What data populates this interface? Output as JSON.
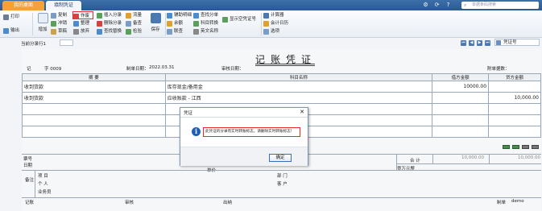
{
  "tabs": [
    {
      "label": "我的桌面"
    },
    {
      "label": "填制凭证"
    }
  ],
  "search": {
    "placeholder": "单据条码搜索"
  },
  "ribbon": {
    "print_label": "打印",
    "output_label": "输出",
    "add_label": "增加",
    "copy_label": "复制",
    "reverse_label": "冲销",
    "draft_label": "草稿",
    "void_label": "作废",
    "organize_label": "整理",
    "abandon_label": "放弃",
    "insert_entry_label": "插入分录",
    "delete_entry_label": "删除分录",
    "find_replace_label": "查找替换",
    "flow_label": "流量",
    "note_label": "备查",
    "check_label": "检验",
    "save_label": "保存",
    "aux_detail_label": "辅助明细",
    "balance_label": "余额",
    "link_label": "联查",
    "find_voucher_label": "查找分单",
    "subject_convert_label": "科目转换",
    "flow_convert_label": "英文名称",
    "show_voucher_no_label": "显示空凭证号",
    "calculator_label": "计算器",
    "accounting_calendar_label": "会计日历",
    "options_label": "选项"
  },
  "toolbar2": {
    "attach_label": "当前分录行1",
    "search_field": "凭证号"
  },
  "voucher": {
    "title": "记账凭证",
    "type_label": "记",
    "number_label": "字 0009",
    "date_label": "制单日期：",
    "date_value": "2022.03.31",
    "audit_label": "审核日期：",
    "attach_label": "附单据数：",
    "col_summary": "摘 要",
    "col_subject": "科目名称",
    "col_debit": "借方金额",
    "col_credit": "贷方金额",
    "rows": [
      {
        "summary": "收到货款",
        "subject": "库存现金/备用金",
        "debit": "10000.00",
        "credit": ""
      },
      {
        "summary": "收到货款",
        "subject": "应收账款 - 江西",
        "debit": "",
        "credit": "10,000.00"
      },
      {
        "summary": "",
        "subject": "",
        "debit": "",
        "credit": ""
      },
      {
        "summary": "",
        "subject": "",
        "debit": "",
        "credit": ""
      },
      {
        "summary": "",
        "subject": "",
        "debit": "",
        "credit": ""
      }
    ],
    "bill_no_label": "票号",
    "bill_date_label": "日期",
    "quantity_label": "数量",
    "price_label": "单价",
    "total_label": "合 计",
    "total_debit": "10,000.00",
    "total_credit": "10,000.00",
    "amount_in_words": "壹万元整",
    "note_label": "备注",
    "project_label": "项 目",
    "dept_label": "部 门",
    "person_label": "个 人",
    "customer_label": "客 户",
    "salesman_label": "业务员",
    "bookkeeper_label": "记账",
    "reviewer_label": "审核",
    "cashier_label": "出纳",
    "maker_label": "制单",
    "maker_value": "demo"
  },
  "dialog": {
    "title": "凭证",
    "message": "此凭证的分录有实时转账标志，请删除实时转账标志！",
    "ok_label": "确定"
  }
}
